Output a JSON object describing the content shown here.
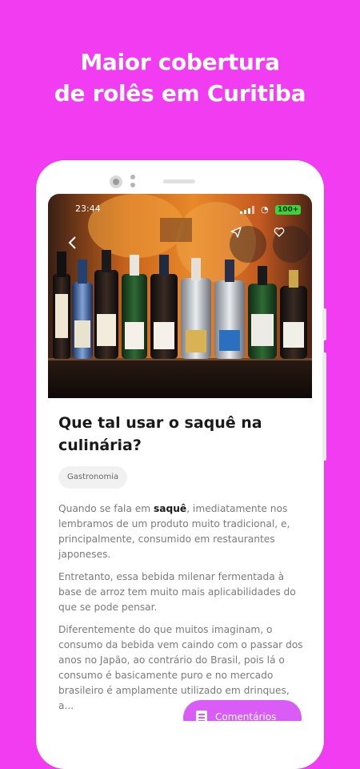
{
  "promo": {
    "line1": "Maior cobertura",
    "line2": "de rolês em Curitiba"
  },
  "status_bar": {
    "time": "23:44",
    "battery": "100+"
  },
  "article": {
    "title": "Que tal usar o saquê na culinária?",
    "category": "Gastronomia",
    "paragraph1_before": "Quando se fala em ",
    "paragraph1_bold": "saquê",
    "paragraph1_after": ", imediatamente nos lembramos de um produto muito tradicional, e, principalmente, consumido em restaurantes japoneses.",
    "paragraph2": "Entretanto, essa bebida milenar fermentada à base de arroz tem muito mais aplicabilidades do que se pode pensar.",
    "paragraph3": "Diferentemente do que muitos imaginam, o consumo da bebida vem caindo com o passar dos anos no Japão, ao contrário do Brasil, pois lá o consumo é basicamente puro e no mercado brasileiro é amplamente utilizado em drinques, a..."
  },
  "actions": {
    "comments_label": "Comentários"
  },
  "icons": {
    "back": "chevron-left-icon",
    "share": "send-icon",
    "favorite": "heart-icon",
    "comments": "document-icon"
  },
  "colors": {
    "background": "#f23cf2",
    "fab": "#d85cf5"
  }
}
